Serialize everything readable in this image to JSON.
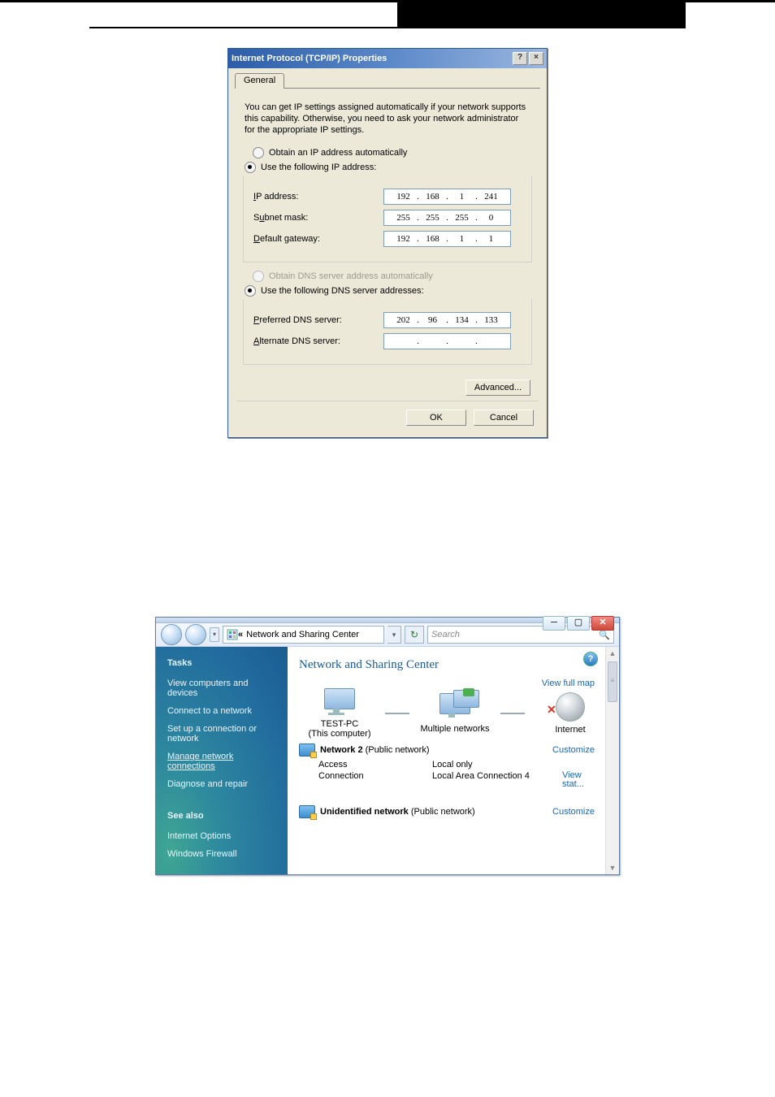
{
  "dialog1": {
    "title": "Internet Protocol (TCP/IP) Properties",
    "tab": "General",
    "intro": "You can get IP settings assigned automatically if your network supports this capability. Otherwise, you need to ask your network administrator for the appropriate IP settings.",
    "radio_auto_ip": "Obtain an IP address automatically",
    "radio_static_ip": "Use the following IP address:",
    "ip_label": "IP address:",
    "ip_value": [
      "192",
      "168",
      "1",
      "241"
    ],
    "subnet_label": "Subnet mask:",
    "subnet_value": [
      "255",
      "255",
      "255",
      "0"
    ],
    "gateway_label": "Default gateway:",
    "gateway_value": [
      "192",
      "168",
      "1",
      "1"
    ],
    "radio_auto_dns": "Obtain DNS server address automatically",
    "radio_static_dns": "Use the following DNS server addresses:",
    "pref_dns_label": "Preferred DNS server:",
    "pref_dns_value": [
      "202",
      "96",
      "134",
      "133"
    ],
    "alt_dns_label": "Alternate DNS server:",
    "alt_dns_value": [
      "",
      "",
      "",
      ""
    ],
    "advanced": "Advanced...",
    "ok": "OK",
    "cancel": "Cancel",
    "help_glyph": "?",
    "close_glyph": "×"
  },
  "dialog2": {
    "breadcrumb": "Network and Sharing Center",
    "search_placeholder": "Search",
    "sidebar": {
      "tasks_head": "Tasks",
      "links": [
        "View computers and devices",
        "Connect to a network",
        "Set up a connection or network",
        "Manage network connections",
        "Diagnose and repair"
      ],
      "seealso_head": "See also",
      "seealso": [
        "Internet Options",
        "Windows Firewall"
      ]
    },
    "content": {
      "title": "Network and Sharing Center",
      "view_map": "View full map",
      "map_nodes": {
        "pc_name": "TEST-PC",
        "pc_sub": "(This computer)",
        "middle": "Multiple networks",
        "internet": "Internet"
      },
      "net1": {
        "name": "Network 2",
        "type": "(Public network)",
        "customize": "Customize",
        "row_access_l": "Access",
        "row_access_v": "Local only",
        "row_conn_l": "Connection",
        "row_conn_v": "Local Area Connection 4",
        "view_stat": "View stat..."
      },
      "net2": {
        "name": "Unidentified network",
        "type": "(Public network)",
        "customize": "Customize"
      }
    }
  }
}
